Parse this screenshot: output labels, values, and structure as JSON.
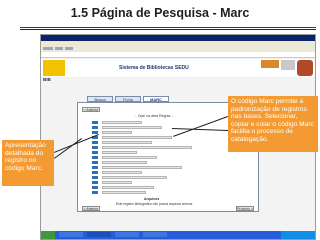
{
  "slide": {
    "title": "1.5 Página de Pesquisa - Marc"
  },
  "browser": {
    "header_title": "Sistema de Bibliotecas SEDU",
    "logo_label": "BIB",
    "tabs": [
      {
        "label": "Busca"
      },
      {
        "label": "Ficha"
      },
      {
        "label": "MARC"
      }
    ],
    "nav_left": "< Anterior",
    "nav_right": "Próximo >",
    "center_caption": "... Ops! na área Regras ...",
    "bottom_caption": "Arquivos",
    "bottom_caption2": "Este registro bibliográfico não possui arquivos anexos."
  },
  "callouts": {
    "right": "O código Marc permite a padronização de registros nas bases. Selecionar, copiar e colar o código Marc facilita o processo de catalogação.",
    "left": "Apresentação detalhada do registro no código Marc."
  },
  "colors": {
    "callout": "#f39a33",
    "title_rule": "#2b2bb0",
    "marc_tag": "#2f6fb8"
  }
}
